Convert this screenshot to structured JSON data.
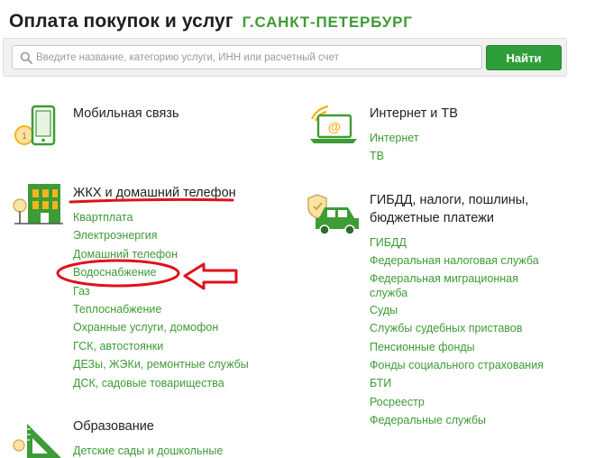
{
  "header": {
    "title": "Оплата покупок и услуг",
    "city": "Г.САНКТ-ПЕТЕРБУРГ"
  },
  "search": {
    "placeholder": "Введите название, категорию услуги, ИНН или расчетный счет",
    "button_label": "Найти"
  },
  "categories": {
    "mobile": {
      "title": "Мобильная связь",
      "icon": "phone-icon"
    },
    "internet": {
      "title": "Интернет и ТВ",
      "icon": "laptop-at-icon",
      "links": [
        "Интернет",
        "ТВ"
      ]
    },
    "housing": {
      "title": "ЖКХ и домашний телефон",
      "icon": "house-icon",
      "links": [
        "Квартплата",
        "Электроэнергия",
        "Домашний телефон",
        "Водоснабжение",
        "Газ",
        "Теплоснабжение",
        "Охранные услуги, домофон",
        "ГСК, автостоянки",
        "ДЕЗы, ЖЭКи, ремонтные службы",
        "ДСК, садовые товарищества"
      ]
    },
    "gibdd": {
      "title_line1": "ГИБДД, налоги, пошлины,",
      "title_line2": "бюджетные платежи",
      "icon": "car-shield-icon",
      "links": [
        "ГИБДД",
        "Федеральная налоговая служба",
        "Федеральная миграционная",
        "служба",
        "Суды",
        "Службы судебных приставов",
        "Пенсионные фонды",
        "Фонды социального страхования",
        "БТИ",
        "Росреестр",
        "Федеральные службы"
      ]
    },
    "education": {
      "title": "Образование",
      "icon": "ruler-triangle-icon",
      "links": [
        "Детские сады и дошкольные"
      ]
    }
  },
  "colors": {
    "green": "#3e9b35",
    "button": "#2f9e3a",
    "annotation_red": "#e0121b",
    "icon_yellow": "#f2b51e"
  }
}
